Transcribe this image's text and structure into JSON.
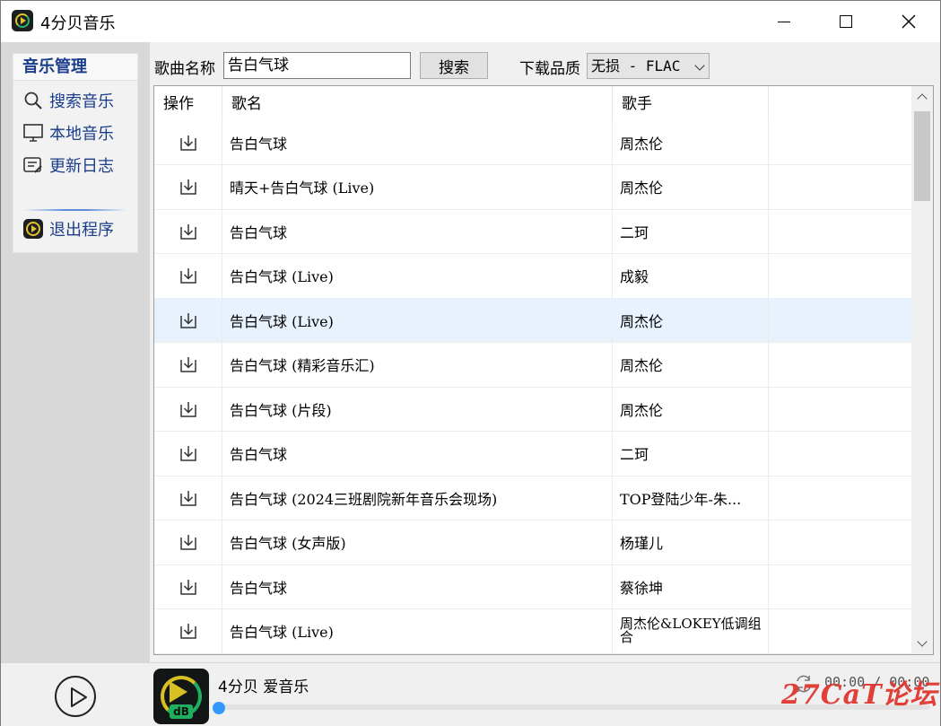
{
  "window": {
    "title": "4分贝音乐"
  },
  "nav": {
    "header": "音乐管理",
    "items": [
      {
        "label": "搜索音乐",
        "icon": "search-icon"
      },
      {
        "label": "本地音乐",
        "icon": "monitor-icon"
      },
      {
        "label": "更新日志",
        "icon": "log-icon"
      }
    ],
    "exit_label": "退出程序"
  },
  "search": {
    "song_label": "歌曲名称",
    "song_value": "告白气球",
    "button_label": "搜索",
    "quality_label": "下载品质",
    "quality_value": "无损 - FLAC"
  },
  "table": {
    "headers": {
      "op": "操作",
      "name": "歌名",
      "artist": "歌手"
    },
    "rows": [
      {
        "name": "告白气球",
        "artist": "周杰伦"
      },
      {
        "name": "晴天+告白气球 (Live)",
        "artist": "周杰伦"
      },
      {
        "name": "告白气球",
        "artist": "二珂"
      },
      {
        "name": "告白气球 (Live)",
        "artist": "成毅"
      },
      {
        "name": "告白气球 (Live)",
        "artist": "周杰伦"
      },
      {
        "name": "告白气球 (精彩音乐汇)",
        "artist": "周杰伦"
      },
      {
        "name": "告白气球 (片段)",
        "artist": "周杰伦"
      },
      {
        "name": "告白气球",
        "artist": "二珂"
      },
      {
        "name": "告白气球 (2024三班剧院新年音乐会现场)",
        "artist": "TOP登陆少年-朱..."
      },
      {
        "name": "告白气球 (女声版)",
        "artist": "杨瑾儿"
      },
      {
        "name": "告白气球",
        "artist": "蔡徐坤"
      },
      {
        "name": "告白气球 (Live)",
        "artist": "周杰伦&LOKEY低调组合"
      }
    ],
    "selected_index": 4
  },
  "player": {
    "now_playing": "4分贝  爱音乐",
    "time": "00:00 / 00:00",
    "progress": 0.0,
    "cover_badge": "dB"
  },
  "watermark": "27CaT论坛"
}
